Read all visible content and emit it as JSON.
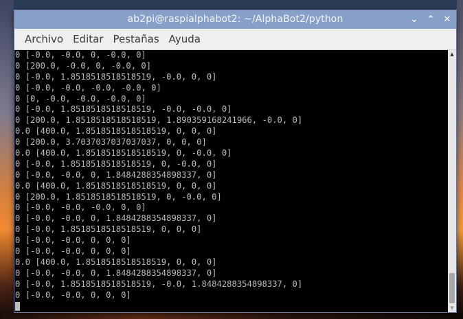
{
  "window": {
    "title": "ab2pi@raspialphabot2: ~/AlphaBot2/python",
    "controls": {
      "minimize_glyph": "⌄",
      "maximize_glyph": "⌃",
      "close_glyph": "✕"
    }
  },
  "menubar": {
    "items": [
      {
        "label": "Archivo"
      },
      {
        "label": "Editar"
      },
      {
        "label": "Pestañas"
      },
      {
        "label": "Ayuda"
      }
    ]
  },
  "terminal": {
    "lines": [
      "0 [-0.0, -0.0, 0, -0.0, 0]",
      "0 [200.0, -0.0, 0, -0.0, 0]",
      "0 [-0.0, 1.8518518518518519, -0.0, 0, 0]",
      "0 [-0.0, -0.0, -0.0, -0.0, 0]",
      "0 [0, -0.0, -0.0, -0.0, 0]",
      "0 [-0.0, 1.8518518518518519, -0.0, -0.0, 0]",
      "0 [200.0, 1.8518518518518519, 1.890359168241966, -0.0, 0]",
      "0.0 [400.0, 1.8518518518518519, 0, 0, 0]",
      "0 [200.0, 3.7037037037037037, 0, 0, 0]",
      "0.0 [400.0, 1.8518518518518519, 0, -0.0, 0]",
      "0 [-0.0, 1.8518518518518519, 0, -0.0, 0]",
      "0 [-0.0, -0.0, 0, 1.8484288354898337, 0]",
      "0.0 [400.0, 1.8518518518518519, 0, 0, 0]",
      "0 [200.0, 1.8518518518518519, 0, -0.0, 0]",
      "0 [-0.0, -0.0, -0.0, 0, 0]",
      "0 [-0.0, -0.0, 0, 1.8484288354898337, 0]",
      "0 [-0.0, 1.8518518518518519, 0, 0, 0]",
      "0 [-0.0, -0.0, 0, 0, 0]",
      "0 [-0.0, -0.0, 0, 0, 0]",
      "0.0 [400.0, 1.8518518518518519, 0, 0, 0]",
      "0 [-0.0, -0.0, 0, 1.8484288354898337, 0]",
      "0 [-0.0, 1.8518518518518519, -0.0, 1.8484288354898337, 0]",
      "0 [-0.0, -0.0, 0, 0, 0]"
    ]
  },
  "scrollbar": {
    "up_glyph": "▲",
    "down_glyph": "▼"
  }
}
